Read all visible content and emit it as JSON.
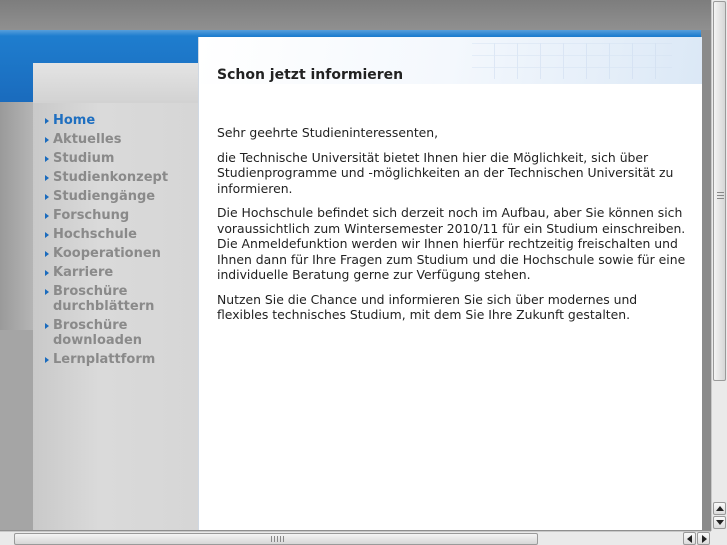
{
  "nav": {
    "items": [
      {
        "label": "Home",
        "active": true
      },
      {
        "label": "Aktuelles"
      },
      {
        "label": "Studium"
      },
      {
        "label": "Studienkonzept"
      },
      {
        "label": "Studiengänge"
      },
      {
        "label": "Forschung"
      },
      {
        "label": "Hochschule"
      },
      {
        "label": "Kooperationen"
      },
      {
        "label": "Karriere"
      },
      {
        "label": "Broschüre durchblättern",
        "lines": [
          "Broschüre",
          "durchblättern"
        ]
      },
      {
        "label": "Broschüre downloaden",
        "lines": [
          "Broschüre",
          "downloaden"
        ]
      },
      {
        "label": "Lernplattform"
      }
    ]
  },
  "main": {
    "heading": "Schon jetzt informieren",
    "paragraphs": [
      "Sehr geehrte Studieninteressenten,",
      "die Technische Universität bietet Ihnen hier die Möglichkeit, sich über Studienprogramme und -möglichkeiten an der Technischen Universität zu informieren.",
      "Die Hochschule befindet sich derzeit noch im Aufbau, aber Sie können sich voraussichtlich zum Wintersemester 2010/11 für ein Studium einschreiben. Die Anmeldefunktion werden wir Ihnen hierfür rechtzeitig freischalten und Ihnen dann für Ihre Fragen zum Studium und die Hochschule sowie für eine individuelle Beratung gerne zur Verfügung stehen.",
      "Nutzen Sie die Chance und informieren Sie sich über modernes und flexibles technisches Studium, mit dem Sie Ihre Zukunft gestalten."
    ]
  },
  "theme": {
    "accent": "#1a6bbd",
    "nav_inactive": "#8a8a8a",
    "nav_active": "#1f6fc0"
  }
}
